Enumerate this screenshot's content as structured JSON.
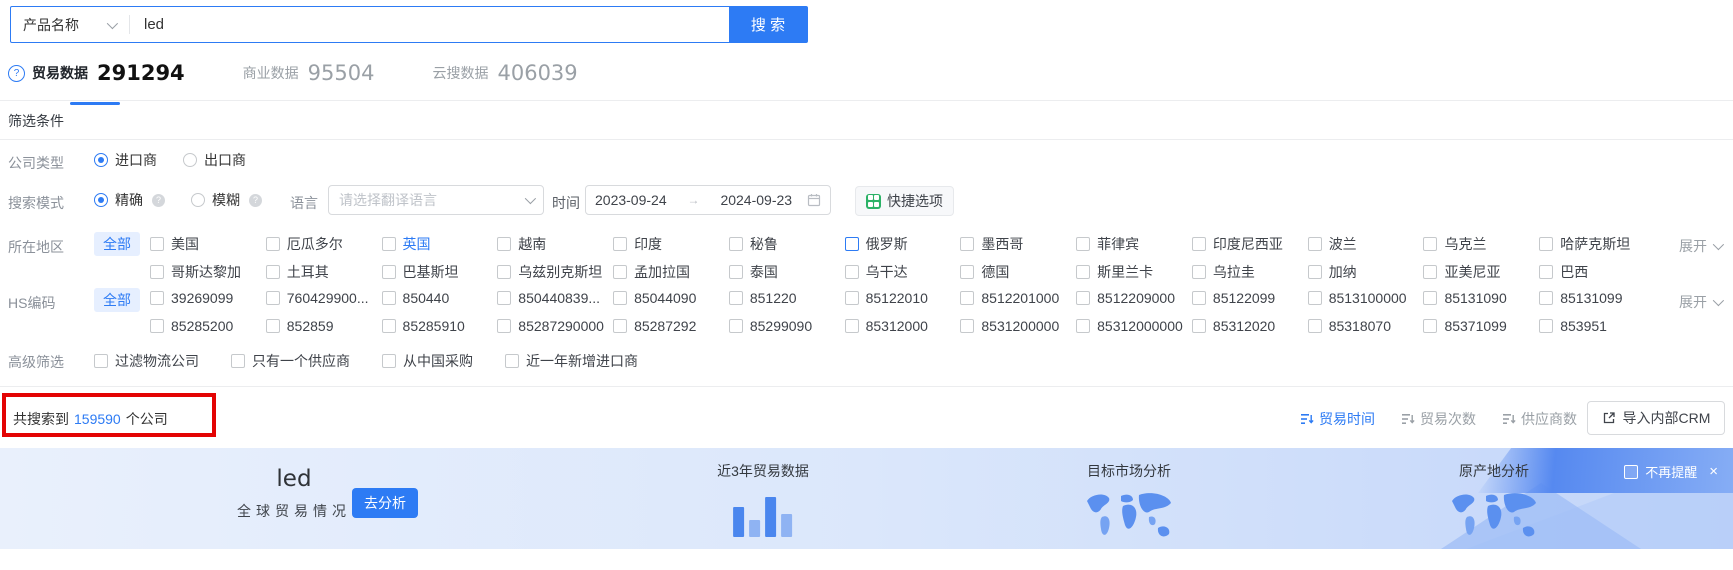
{
  "colors": {
    "accent": "#2d7bf4",
    "annotation_red": "#e30303",
    "quick_green": "#2cb267"
  },
  "search": {
    "category": "产品名称",
    "query": "led",
    "button": "搜 索"
  },
  "tabs": [
    {
      "label": "贸易数据",
      "count": "291294"
    },
    {
      "label": "商业数据",
      "count": "95504"
    },
    {
      "label": "云搜数据",
      "count": "406039"
    }
  ],
  "filter": {
    "title": "筛选条件",
    "company_type": {
      "label": "公司类型",
      "options": [
        {
          "label": "进口商"
        },
        {
          "label": "出口商"
        }
      ]
    },
    "search_mode": {
      "label": "搜索模式",
      "options": [
        {
          "label": "精确"
        },
        {
          "label": "模糊"
        }
      ],
      "language_label": "语言",
      "language_placeholder": "请选择翻译语言",
      "time_label": "时间",
      "date_start": "2023-09-24",
      "date_arrow": "→",
      "date_end": "2024-09-23",
      "quick_button": "快捷选项"
    },
    "region": {
      "label": "所在地区",
      "all": "全部",
      "expand": "展开",
      "row1": [
        {
          "label": "美国"
        },
        {
          "label": "厄瓜多尔"
        },
        {
          "label": "英国",
          "cls": "hl-text"
        },
        {
          "label": "越南"
        },
        {
          "label": "印度"
        },
        {
          "label": "秘鲁"
        },
        {
          "label": "俄罗斯",
          "cls": "hl-box"
        },
        {
          "label": "墨西哥"
        },
        {
          "label": "菲律宾"
        },
        {
          "label": "印度尼西亚"
        },
        {
          "label": "波兰"
        },
        {
          "label": "乌克兰"
        },
        {
          "label": "哈萨克斯坦"
        }
      ],
      "row2": [
        {
          "label": "哥斯达黎加"
        },
        {
          "label": "土耳其"
        },
        {
          "label": "巴基斯坦"
        },
        {
          "label": "乌兹别克斯坦"
        },
        {
          "label": "孟加拉国"
        },
        {
          "label": "泰国"
        },
        {
          "label": "乌干达"
        },
        {
          "label": "德国"
        },
        {
          "label": "斯里兰卡"
        },
        {
          "label": "乌拉圭"
        },
        {
          "label": "加纳"
        },
        {
          "label": "亚美尼亚"
        },
        {
          "label": "巴西"
        }
      ]
    },
    "hs": {
      "label": "HS编码",
      "all": "全部",
      "expand": "展开",
      "row1": [
        {
          "label": "39269099"
        },
        {
          "label": "760429900..."
        },
        {
          "label": "850440"
        },
        {
          "label": "850440839..."
        },
        {
          "label": "85044090"
        },
        {
          "label": "851220"
        },
        {
          "label": "85122010"
        },
        {
          "label": "8512201000"
        },
        {
          "label": "8512209000"
        },
        {
          "label": "85122099"
        },
        {
          "label": "8513100000"
        },
        {
          "label": "85131090"
        },
        {
          "label": "85131099"
        }
      ],
      "row2": [
        {
          "label": "85285200"
        },
        {
          "label": "852859"
        },
        {
          "label": "85285910"
        },
        {
          "label": "85287290000"
        },
        {
          "label": "85287292"
        },
        {
          "label": "85299090"
        },
        {
          "label": "85312000"
        },
        {
          "label": "8531200000"
        },
        {
          "label": "85312000000"
        },
        {
          "label": "85312020"
        },
        {
          "label": "85318070"
        },
        {
          "label": "85371099"
        },
        {
          "label": "853951"
        }
      ]
    },
    "advanced": {
      "label": "高级筛选",
      "options": [
        {
          "label": "过滤物流公司"
        },
        {
          "label": "只有一个供应商"
        },
        {
          "label": "从中国采购"
        },
        {
          "label": "近一年新增进口商"
        }
      ]
    }
  },
  "results": {
    "prefix": "共搜索到",
    "count": "159590",
    "suffix": "个公司",
    "sorts": [
      {
        "label": "贸易时间"
      },
      {
        "label": "贸易次数"
      },
      {
        "label": "供应商数"
      }
    ],
    "crm_button": "导入内部CRM"
  },
  "banner": {
    "keyword": "led",
    "subtitle": "全球贸易情况",
    "analyze_button": "去分析",
    "cards": [
      {
        "title": "近3年贸易数据"
      },
      {
        "title": "目标市场分析"
      },
      {
        "title": "原产地分析"
      }
    ],
    "dismiss": "不再提醒",
    "close": "×",
    "chart_bars": [
      30,
      17,
      40,
      23
    ]
  }
}
